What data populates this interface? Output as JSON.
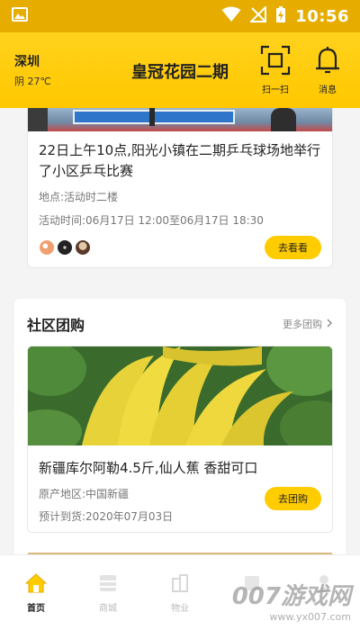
{
  "status_bar": {
    "time": "10:56"
  },
  "header": {
    "city": "深圳",
    "weather": "阴 27℃",
    "title": "皇冠花园二期",
    "scan_label": "扫一扫",
    "message_label": "消息"
  },
  "activity": {
    "title": "22日上午10点,阳光小镇在二期乒乓球场地举行了小区乒乓比赛",
    "location": "地点:活动时二楼",
    "time": "活动时间:06月17日 12:00至06月17日 18:30",
    "button": "去看看"
  },
  "group_buy": {
    "section_title": "社区团购",
    "more_label": "更多团购",
    "item": {
      "title": "新疆库尔阿勒4.5斤,仙人蕉 香甜可口",
      "origin": "原产地区:中国新疆",
      "eta": "预计到货:2020年07月03日",
      "button": "去团购"
    }
  },
  "bottom_nav": {
    "items": [
      {
        "label": "首页",
        "icon": "home-icon",
        "active": true
      },
      {
        "label": "商城",
        "icon": "shop-icon",
        "active": false
      },
      {
        "label": "物业",
        "icon": "property-icon",
        "active": false
      },
      {
        "label": "",
        "icon": "service-icon",
        "active": false
      },
      {
        "label": "",
        "icon": "user-icon",
        "active": false
      }
    ]
  },
  "watermark": {
    "main": "007游戏网",
    "url": "www.yx007.com"
  },
  "colors": {
    "brand_yellow": "#ffcc00",
    "status_bar": "#e6ad00"
  }
}
